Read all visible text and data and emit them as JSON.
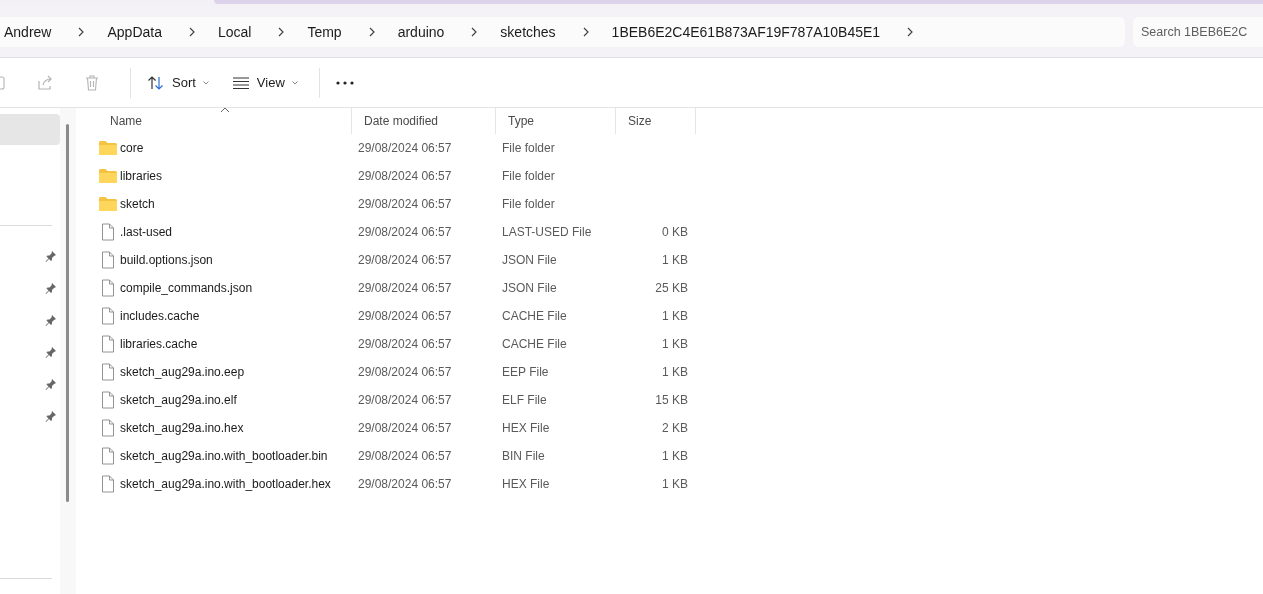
{
  "breadcrumb": [
    "Andrew",
    "AppData",
    "Local",
    "Temp",
    "arduino",
    "sketches",
    "1BEB6E2C4E61B873AF19F787A10B45E1"
  ],
  "search": {
    "placeholder": "Search 1BEB6E2C"
  },
  "toolbar": {
    "cut": {
      "disabled": true
    },
    "share": {
      "disabled": true
    },
    "delete": {
      "disabled": true
    },
    "sort": {
      "label": "Sort"
    },
    "view": {
      "label": "View"
    }
  },
  "sidebar": {
    "items": [
      {
        "selected": true,
        "pinned": false
      },
      {
        "selected": false,
        "pinned": true
      },
      {
        "selected": false,
        "pinned": true
      },
      {
        "selected": false,
        "pinned": true
      },
      {
        "selected": false,
        "pinned": true
      },
      {
        "selected": false,
        "pinned": true
      },
      {
        "selected": false,
        "pinned": true
      }
    ]
  },
  "table": {
    "columns": [
      {
        "label": "Name",
        "sorted": true
      },
      {
        "label": "Date modified",
        "sorted": false
      },
      {
        "label": "Type",
        "sorted": false
      },
      {
        "label": "Size",
        "sorted": false
      }
    ],
    "rows": [
      {
        "kind": "folder",
        "name": "core",
        "date": "29/08/2024 06:57",
        "type": "File folder"
      },
      {
        "kind": "folder",
        "name": "libraries",
        "date": "29/08/2024 06:57",
        "type": "File folder"
      },
      {
        "kind": "folder",
        "name": "sketch",
        "date": "29/08/2024 06:57",
        "type": "File folder"
      },
      {
        "kind": "file",
        "name": ".last-used",
        "date": "29/08/2024 06:57",
        "type": "LAST-USED File",
        "size": "0 KB"
      },
      {
        "kind": "file",
        "name": "build.options.json",
        "date": "29/08/2024 06:57",
        "type": "JSON File",
        "size": "1 KB"
      },
      {
        "kind": "file",
        "name": "compile_commands.json",
        "date": "29/08/2024 06:57",
        "type": "JSON File",
        "size": "25 KB"
      },
      {
        "kind": "file",
        "name": "includes.cache",
        "date": "29/08/2024 06:57",
        "type": "CACHE File",
        "size": "1 KB"
      },
      {
        "kind": "file",
        "name": "libraries.cache",
        "date": "29/08/2024 06:57",
        "type": "CACHE File",
        "size": "1 KB"
      },
      {
        "kind": "file",
        "name": "sketch_aug29a.ino.eep",
        "date": "29/08/2024 06:57",
        "type": "EEP File",
        "size": "1 KB"
      },
      {
        "kind": "file",
        "name": "sketch_aug29a.ino.elf",
        "date": "29/08/2024 06:57",
        "type": "ELF File",
        "size": "15 KB"
      },
      {
        "kind": "file",
        "name": "sketch_aug29a.ino.hex",
        "date": "29/08/2024 06:57",
        "type": "HEX File",
        "size": "2 KB"
      },
      {
        "kind": "file",
        "name": "sketch_aug29a.ino.with_bootloader.bin",
        "date": "29/08/2024 06:57",
        "type": "BIN File",
        "size": "1 KB"
      },
      {
        "kind": "file",
        "name": "sketch_aug29a.ino.with_bootloader.hex",
        "date": "29/08/2024 06:57",
        "type": "HEX File",
        "size": "1 KB"
      }
    ]
  }
}
